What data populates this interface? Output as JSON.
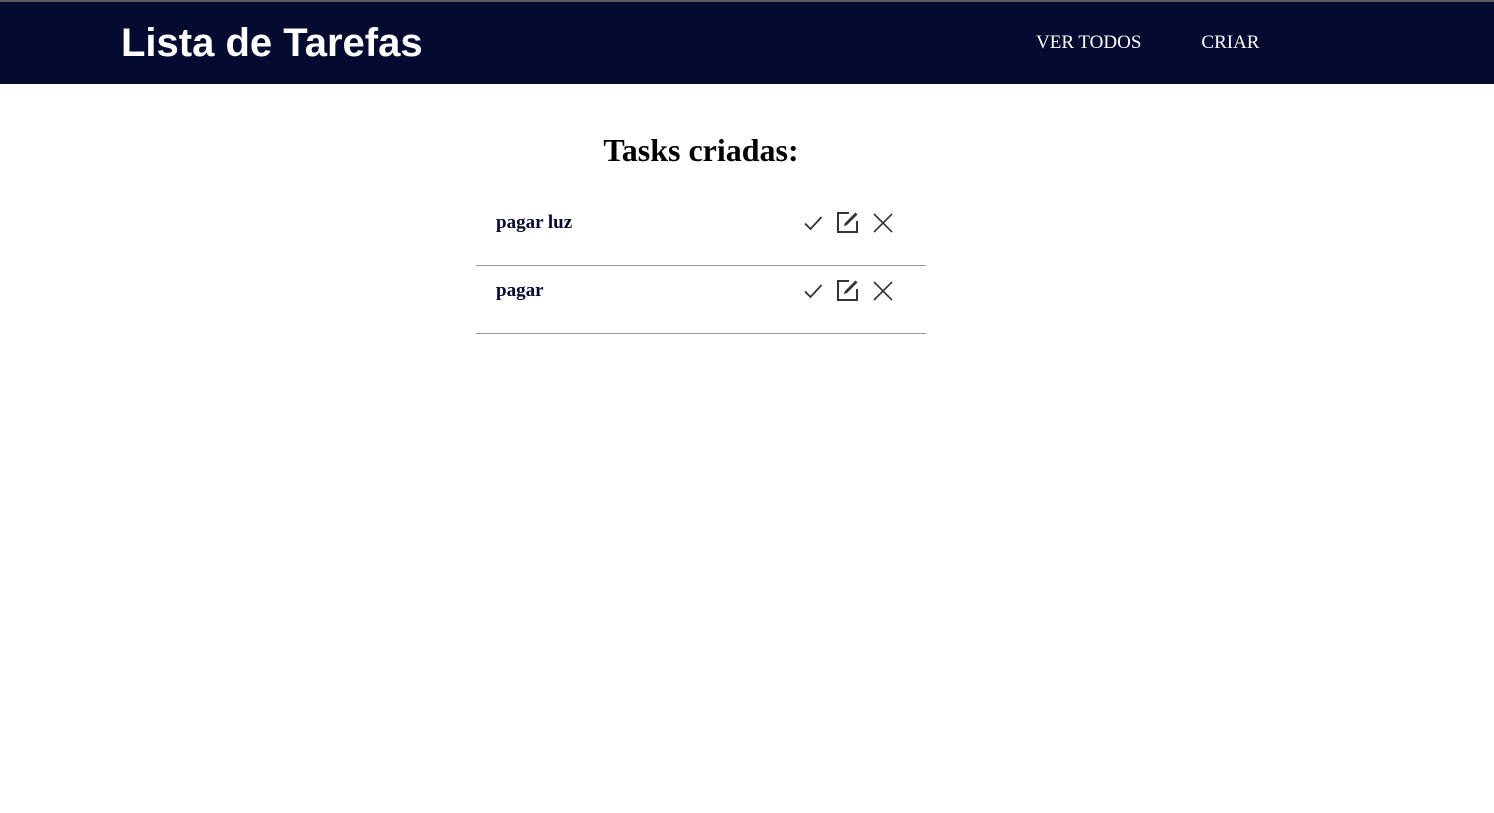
{
  "header": {
    "brand": "Lista de Tarefas",
    "nav": [
      {
        "label": "VER TODOS"
      },
      {
        "label": "CRIAR"
      }
    ]
  },
  "main": {
    "title": "Tasks criadas:",
    "tasks": [
      {
        "name": "pagar luz",
        "actions": [
          "check-icon",
          "edit-icon",
          "close-icon"
        ]
      },
      {
        "name": "pagar",
        "actions": [
          "check-icon",
          "edit-icon",
          "close-icon"
        ]
      }
    ]
  },
  "colors": {
    "navbar_bg": "#050a30",
    "nav_text": "#ffffff",
    "task_text": "#050a30",
    "icon": "#333333",
    "divider": "#9a9a9a"
  }
}
